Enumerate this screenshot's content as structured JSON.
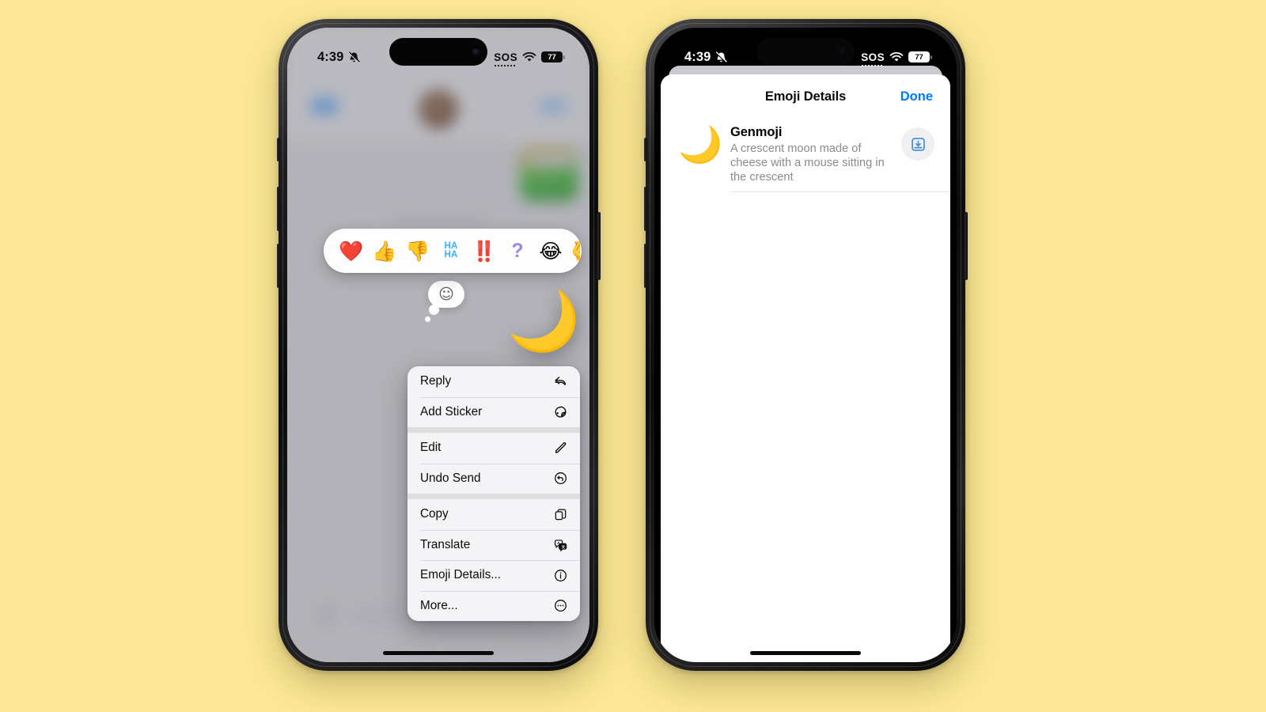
{
  "background_color": "#fce896",
  "accent_blue": "#007aff",
  "status_bar": {
    "time": "4:39",
    "silent_icon": "bell-slash-icon",
    "sos_label": "SOS",
    "wifi_icon": "wifi-icon",
    "battery_level": "77"
  },
  "left_phone": {
    "name": "messages-context-menu-screen",
    "reaction_bar": {
      "reactions": [
        {
          "name": "heart",
          "glyph": "❤️",
          "kind": "emoji"
        },
        {
          "name": "thumbs-up",
          "glyph": "👍",
          "kind": "emoji"
        },
        {
          "name": "thumbs-down",
          "glyph": "👎",
          "kind": "emoji"
        },
        {
          "name": "haha",
          "glyph": "HA HA",
          "kind": "haha"
        },
        {
          "name": "double-exclamation",
          "glyph": "‼️",
          "kind": "emoji"
        },
        {
          "name": "question-mark",
          "glyph": "?",
          "kind": "question"
        },
        {
          "name": "laughing",
          "glyph": "😂",
          "kind": "emoji"
        },
        {
          "name": "more-reactions",
          "glyph": "🫰",
          "kind": "clipped"
        }
      ]
    },
    "message": {
      "sticker_name": "genmoji-cheese-moon-mouse",
      "sticker_glyph": "🌙",
      "thought_bubble_glyph": "☺"
    },
    "context_menu": {
      "items": [
        {
          "label": "Reply",
          "icon": "reply-icon",
          "gap_after": false
        },
        {
          "label": "Add Sticker",
          "icon": "sticker-icon",
          "gap_after": true
        },
        {
          "label": "Edit",
          "icon": "pencil-icon",
          "gap_after": false
        },
        {
          "label": "Undo Send",
          "icon": "undo-icon",
          "gap_after": true
        },
        {
          "label": "Copy",
          "icon": "copy-icon",
          "gap_after": false
        },
        {
          "label": "Translate",
          "icon": "translate-icon",
          "gap_after": false
        },
        {
          "label": "Emoji Details...",
          "icon": "info-icon",
          "gap_after": false
        },
        {
          "label": "More...",
          "icon": "ellipsis-icon",
          "gap_after": false
        }
      ]
    }
  },
  "right_phone": {
    "name": "emoji-details-sheet-screen",
    "sheet": {
      "title": "Emoji Details",
      "done_label": "Done",
      "row": {
        "thumbnail_name": "genmoji-cheese-moon-mouse-thumbnail",
        "thumbnail_glyph": "🌙",
        "title": "Genmoji",
        "description": "A crescent moon made of cheese with a mouse sitting in the crescent",
        "save_button_icon": "download-tray-icon"
      }
    }
  }
}
